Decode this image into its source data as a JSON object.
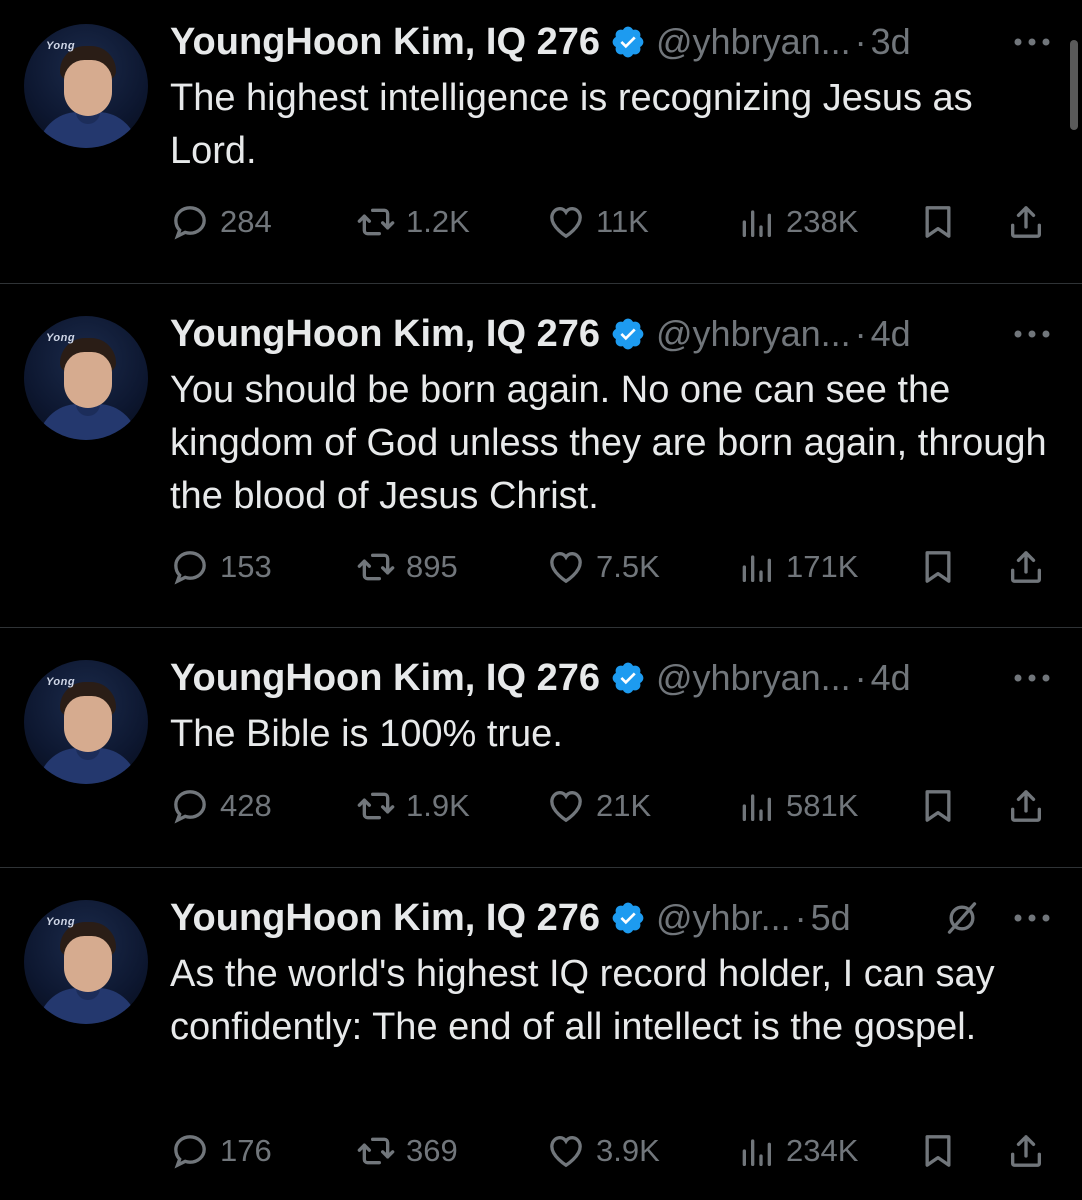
{
  "colors": {
    "background": "#000000",
    "text": "#e7e9ea",
    "secondary": "#71767b",
    "verified": "#1d9bf0",
    "divider": "#2f3336"
  },
  "avatar_brand_text": "Yong",
  "tweets": [
    {
      "name": "YoungHoon Kim, IQ 276",
      "handle": "@yhbryan...",
      "separator": "·",
      "time": "3d",
      "text": "The highest intelligence is recognizing Jesus as Lord.",
      "replies": "284",
      "retweets": "1.2K",
      "likes": "11K",
      "views": "238K"
    },
    {
      "name": "YoungHoon Kim, IQ 276",
      "handle": "@yhbryan...",
      "separator": "·",
      "time": "4d",
      "text": "You should be born again. No one can see the kingdom of God unless they are born again, through the blood of Jesus Christ.",
      "replies": "153",
      "retweets": "895",
      "likes": "7.5K",
      "views": "171K"
    },
    {
      "name": "YoungHoon Kim, IQ 276",
      "handle": "@yhbryan...",
      "separator": "·",
      "time": "4d",
      "text": "The Bible is 100% true.",
      "replies": "428",
      "retweets": "1.9K",
      "likes": "21K",
      "views": "581K"
    },
    {
      "name": "YoungHoon Kim, IQ 276",
      "handle": "@yhbr...",
      "separator": "·",
      "time": "5d",
      "text": "As the world's highest IQ record holder, I can say confidently: The end of all intellect is the gospel.",
      "replies": "176",
      "retweets": "369",
      "likes": "3.9K",
      "views": "234K"
    }
  ],
  "icons": {
    "verified": "verified-badge-icon",
    "more": "more-options-icon",
    "grok": "grok-icon",
    "reply": "reply-icon",
    "retweet": "retweet-icon",
    "like": "heart-icon",
    "views": "views-icon",
    "bookmark": "bookmark-icon",
    "share": "share-icon"
  }
}
